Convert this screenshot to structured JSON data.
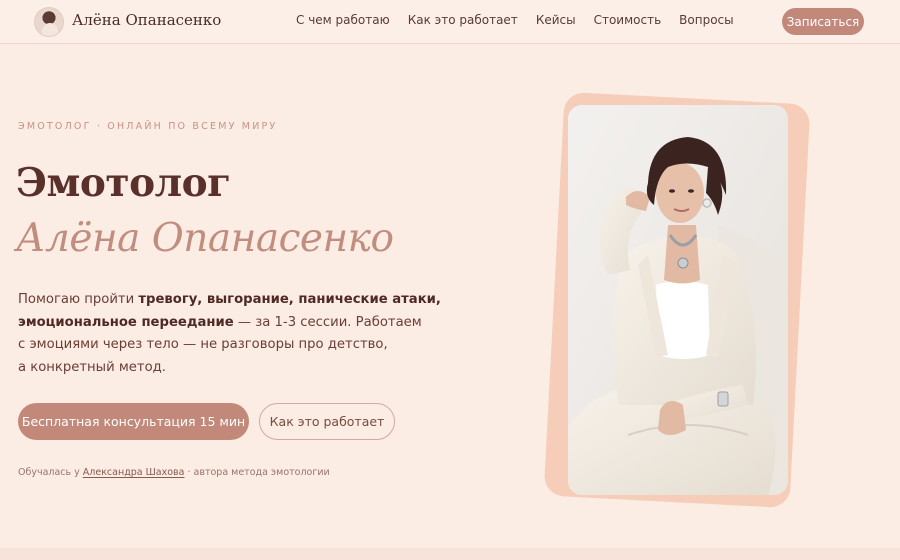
{
  "header": {
    "brand": "Алёна Опанасенко",
    "nav": [
      "С чем работаю",
      "Как это работает",
      "Кейсы",
      "Стоимость",
      "Вопросы"
    ],
    "cta": "Записаться"
  },
  "hero": {
    "eyebrow": "Эмотолог · онлайн по всему миру",
    "title_line1": "Эмотолог",
    "title_line2": "Алёна Опанасенко",
    "lead": {
      "l1_pre": "Помогаю пройти ",
      "l1_bold": "тревогу, выгорание, панические атаки,",
      "l2_bold": "эмоциональное переедание",
      "l2_post": " — за 1-3 сессии. Работаем",
      "l3": "с эмоциями через тело — не разговоры про детство,",
      "l4": "а конкретный метод."
    },
    "btn_primary": "Бесплатная консультация 15 мин",
    "btn_secondary": "Как это работает",
    "note_pre": "Обучалась у ",
    "note_link": "Александра Шахова",
    "note_post": " · автора метода эмотологии"
  },
  "colors": {
    "background": "#fbece4",
    "accent": "#c2887a",
    "heading": "#5a302a",
    "heading_accent": "#c08d7f",
    "card_back": "#f5cdb8"
  }
}
